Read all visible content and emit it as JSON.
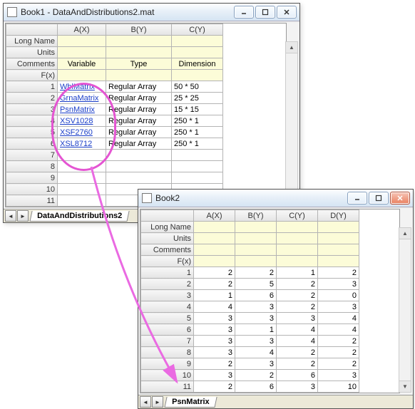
{
  "window1": {
    "title": "Book1 - DataAndDistributions2.mat",
    "columns": [
      "A(X)",
      "B(Y)",
      "C(Y)"
    ],
    "meta_rows": [
      "Long Name",
      "Units",
      "Comments",
      "F(x)"
    ],
    "col_labels": {
      "A": "Variable",
      "B": "Type",
      "C": "Dimension"
    },
    "rows": [
      {
        "n": "1",
        "a": "WblMatrix",
        "b": "Regular Array",
        "c": "50 * 50",
        "link": true
      },
      {
        "n": "2",
        "a": "GrnaMatrix",
        "b": "Regular Array",
        "c": "25 * 25",
        "link": true
      },
      {
        "n": "3",
        "a": "PsnMatrix",
        "b": "Regular Array",
        "c": "15 * 15",
        "link": true
      },
      {
        "n": "4",
        "a": "XSV1028",
        "b": "Regular Array",
        "c": "250 * 1",
        "link": true
      },
      {
        "n": "5",
        "a": "XSF2760",
        "b": "Regular Array",
        "c": "250 * 1",
        "link": true
      },
      {
        "n": "6",
        "a": "XSL8712",
        "b": "Regular Array",
        "c": "250 * 1",
        "link": true
      },
      {
        "n": "7",
        "a": "",
        "b": "",
        "c": ""
      },
      {
        "n": "8",
        "a": "",
        "b": "",
        "c": ""
      },
      {
        "n": "9",
        "a": "",
        "b": "",
        "c": ""
      },
      {
        "n": "10",
        "a": "",
        "b": "",
        "c": ""
      },
      {
        "n": "11",
        "a": "",
        "b": "",
        "c": ""
      }
    ],
    "tab": "DataAndDistributions2"
  },
  "window2": {
    "title": "Book2",
    "columns": [
      "A(X)",
      "B(Y)",
      "C(Y)",
      "D(Y)"
    ],
    "meta_rows": [
      "Long Name",
      "Units",
      "Comments",
      "F(x)"
    ],
    "rows": [
      {
        "n": "1",
        "a": "2",
        "b": "2",
        "c": "1",
        "d": "2"
      },
      {
        "n": "2",
        "a": "2",
        "b": "5",
        "c": "2",
        "d": "3"
      },
      {
        "n": "3",
        "a": "1",
        "b": "6",
        "c": "2",
        "d": "0"
      },
      {
        "n": "4",
        "a": "4",
        "b": "3",
        "c": "2",
        "d": "3"
      },
      {
        "n": "5",
        "a": "3",
        "b": "3",
        "c": "3",
        "d": "4"
      },
      {
        "n": "6",
        "a": "3",
        "b": "1",
        "c": "4",
        "d": "4"
      },
      {
        "n": "7",
        "a": "3",
        "b": "3",
        "c": "4",
        "d": "2"
      },
      {
        "n": "8",
        "a": "3",
        "b": "4",
        "c": "2",
        "d": "2"
      },
      {
        "n": "9",
        "a": "2",
        "b": "3",
        "c": "2",
        "d": "2"
      },
      {
        "n": "10",
        "a": "3",
        "b": "2",
        "c": "6",
        "d": "3"
      },
      {
        "n": "11",
        "a": "2",
        "b": "6",
        "c": "3",
        "d": "10"
      }
    ],
    "tab": "PsnMatrix"
  },
  "icons": {
    "tri_left": "◄",
    "tri_right": "►",
    "tri_up": "▲",
    "tri_down": "▼"
  }
}
